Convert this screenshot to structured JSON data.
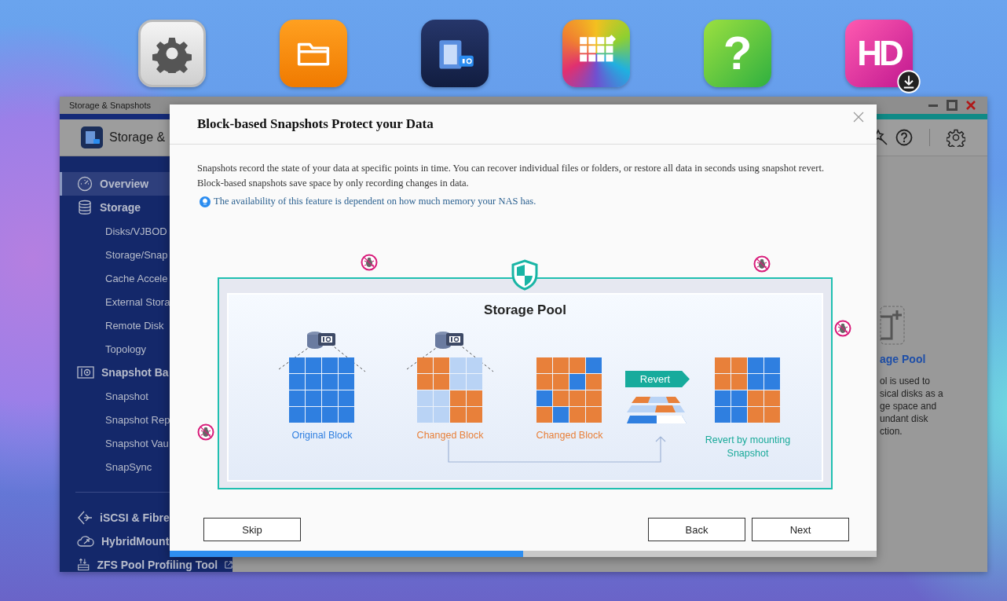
{
  "desktop_icons": [
    {
      "kind": "settings"
    },
    {
      "kind": "folder"
    },
    {
      "kind": "storage"
    },
    {
      "kind": "apps"
    },
    {
      "kind": "help",
      "glyph": "?"
    },
    {
      "kind": "hd",
      "glyph": "HD"
    }
  ],
  "app_window": {
    "title": "Storage & Snapshots",
    "header_title": "Storage &",
    "sidebar_groups": [
      [
        {
          "label": "Overview",
          "selected": true
        },
        {
          "label": "Storage",
          "selected": false,
          "children": [
            {
              "label": "Disks/VJBOD",
              "selected": false
            },
            {
              "label": "Storage/Snap",
              "selected": false
            },
            {
              "label": "Cache Accele",
              "selected": false
            },
            {
              "label": "External Stora",
              "selected": false
            },
            {
              "label": "Remote Disk",
              "selected": false
            },
            {
              "label": "Topology",
              "selected": false
            }
          ]
        },
        {
          "label": "Snapshot Ba",
          "selected": false,
          "children": [
            {
              "label": "Snapshot",
              "selected": false
            },
            {
              "label": "Snapshot Rep",
              "selected": false
            },
            {
              "label": "Snapshot Vau",
              "selected": false
            },
            {
              "label": "SnapSync",
              "selected": false
            }
          ]
        }
      ],
      [
        {
          "label": "iSCSI & Fibre",
          "selected": false
        },
        {
          "label": "HybridMount",
          "selected": false
        },
        {
          "label": "ZFS Pool Profiling Tool",
          "selected": false,
          "external": true
        }
      ]
    ],
    "background_panel": {
      "title": "age Pool",
      "description": "ol is used to\nsical disks as a\nge space and\nundant disk\nction."
    }
  },
  "dialog": {
    "title": "Block-based Snapshots Protect your Data",
    "intro": "Snapshots record the state of your data at specific points in time. You can recover individual files or folders, or restore all data in seconds using snapshot revert. Block-based snapshots save space by only recording changes in data.",
    "note": "The availability of this feature is dependent on how much memory your NAS has.",
    "diagram": {
      "title": "Storage Pool",
      "revert_tag": "Revert",
      "stages": [
        {
          "label": "Original Block",
          "color": "#2f7fe0"
        },
        {
          "label": "Changed Block",
          "color": "#e8803a"
        },
        {
          "label": "Changed Block",
          "color": "#e8803a"
        },
        {
          "label": "Revert by mounting Snapshot",
          "color": "#1aaa9a"
        }
      ]
    },
    "buttons": [
      {
        "label": "Skip"
      },
      {
        "label": "Back"
      },
      {
        "label": "Next"
      }
    ],
    "progress": {
      "level": 0.5
    }
  }
}
